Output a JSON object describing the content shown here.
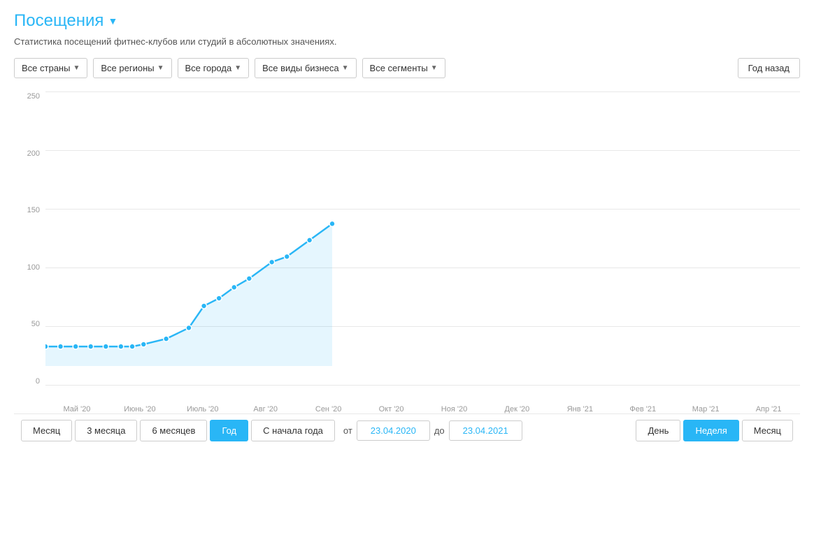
{
  "header": {
    "title": "Посещения",
    "chevron": "▼"
  },
  "subtitle": "Статистика посещений фитнес-клубов или студий в абсолютных значениях.",
  "filters": [
    {
      "id": "countries",
      "label": "Все страны"
    },
    {
      "id": "regions",
      "label": "Все регионы"
    },
    {
      "id": "cities",
      "label": "Все города"
    },
    {
      "id": "business",
      "label": "Все виды бизнеса"
    },
    {
      "id": "segments",
      "label": "Все сегменты"
    }
  ],
  "year_btn": "Год назад",
  "y_labels": [
    "0",
    "50",
    "100",
    "150",
    "200",
    "250"
  ],
  "x_labels": [
    "Май '20",
    "Июнь '20",
    "Июль '20",
    "Авг '20",
    "Сен '20",
    "Окт '20",
    "Ноя '20",
    "Дек '20",
    "Янв '21",
    "Фев '21",
    "Мар '21",
    "Апр '21"
  ],
  "time_range_btns": [
    {
      "id": "month",
      "label": "Месяц",
      "active": false
    },
    {
      "id": "3months",
      "label": "3 месяца",
      "active": false
    },
    {
      "id": "6months",
      "label": "6 месяцев",
      "active": false
    },
    {
      "id": "year",
      "label": "Год",
      "active": true
    },
    {
      "id": "ytd",
      "label": "С начала года",
      "active": false
    }
  ],
  "date_from_label": "от",
  "date_to_label": "до",
  "date_from": "23.04.2020",
  "date_to": "23.04.2021",
  "granularity_btns": [
    {
      "id": "day",
      "label": "День",
      "active": false
    },
    {
      "id": "week",
      "label": "Неделя",
      "active": true
    },
    {
      "id": "month_gran",
      "label": "Месяц",
      "active": false
    }
  ]
}
